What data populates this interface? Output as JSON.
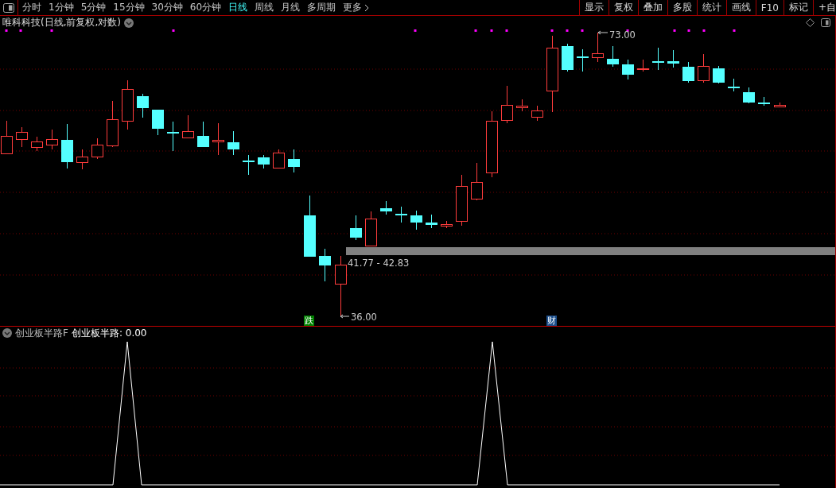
{
  "toolbar": {
    "periods": [
      {
        "label": "分时",
        "selected": false
      },
      {
        "label": "1分钟",
        "selected": false
      },
      {
        "label": "5分钟",
        "selected": false
      },
      {
        "label": "15分钟",
        "selected": false
      },
      {
        "label": "30分钟",
        "selected": false
      },
      {
        "label": "60分钟",
        "selected": false
      },
      {
        "label": "日线",
        "selected": true
      },
      {
        "label": "周线",
        "selected": false
      },
      {
        "label": "月线",
        "selected": false
      },
      {
        "label": "多周期",
        "selected": false
      },
      {
        "label": "更多",
        "selected": false
      }
    ],
    "buttons": [
      "显示",
      "复权",
      "叠加",
      "多股",
      "统计",
      "画线",
      "F10",
      "标记",
      "+自"
    ]
  },
  "main_panel": {
    "title": "唯科科技(日线,前复权,对数)",
    "high_label": "73.00",
    "range_label": "41.77 - 42.83",
    "low_label": "36.00",
    "markers": [
      {
        "text": "跌",
        "color": "#008000"
      },
      {
        "text": "财",
        "color": "#1c4f8c"
      }
    ]
  },
  "indicator_panel": {
    "name": "创业板半路F",
    "reading": "创业板半路: 0.00"
  }
}
